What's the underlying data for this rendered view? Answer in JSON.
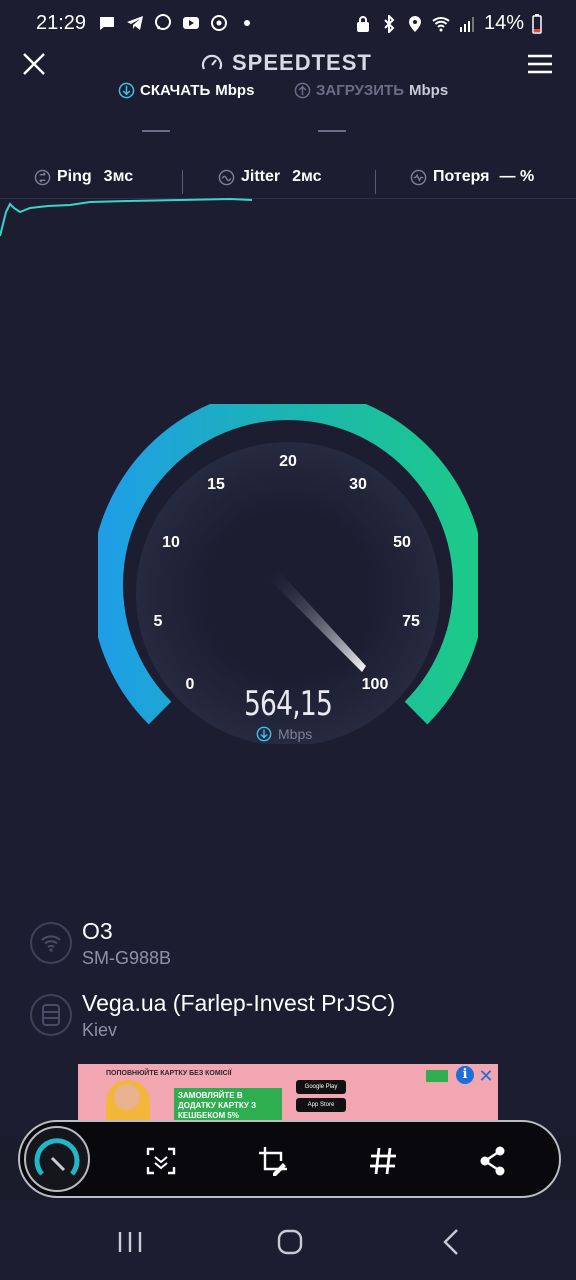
{
  "status": {
    "time": "21:29",
    "battery": "14%"
  },
  "header": {
    "brand": "SPEEDTEST"
  },
  "tabs": {
    "download_label": "СКАЧАТЬ",
    "download_unit": "Mbps",
    "upload_label": "ЗАГРУЗИТЬ",
    "upload_unit": "Mbps"
  },
  "metrics": {
    "ping_label": "Ping",
    "ping_value": "3мс",
    "jitter_label": "Jitter",
    "jitter_value": "2мс",
    "loss_label": "Потеря",
    "loss_value": "— %"
  },
  "gauge": {
    "ticks": [
      "0",
      "5",
      "10",
      "15",
      "20",
      "30",
      "50",
      "75",
      "100"
    ],
    "speed_value": "564,15",
    "speed_unit": "Mbps",
    "colors": {
      "start": "#1f9ee6",
      "end": "#1dc98a"
    }
  },
  "connection": {
    "network_name": "O3",
    "device": "SM-G988B",
    "server_name": "Vega.ua (Farlep-Invest PrJSC)",
    "server_city": "Kiev"
  },
  "ad": {
    "headline": "ПОПОВНЮЙТЕ КАРТКУ БЕЗ КОМІСІЇ",
    "cta": "ЗАМОВЛЯЙТЕ В ДОДАТКУ КАРТКУ З КЕШБЕКОМ 5%",
    "store1": "Google Play",
    "store2": "App Store"
  },
  "toolbar": {
    "icons": [
      "speed-gauge-icon",
      "scan-icon",
      "crop-edit-icon",
      "hashtag-icon",
      "share-icon"
    ]
  }
}
